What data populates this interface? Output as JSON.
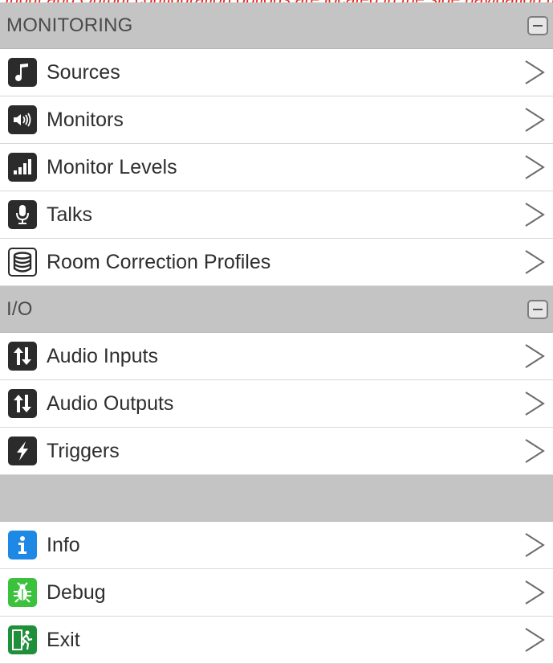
{
  "top_annotation": "Input and Output configuration options are located in the side navigation menu settings",
  "sections": [
    {
      "title": "MONITORING",
      "items": [
        {
          "label": "Sources",
          "icon": "music-note-icon"
        },
        {
          "label": "Monitors",
          "icon": "speaker-volume-icon"
        },
        {
          "label": "Monitor Levels",
          "icon": "signal-bars-icon"
        },
        {
          "label": "Talks",
          "icon": "microphone-icon"
        },
        {
          "label": "Room Correction Profiles",
          "icon": "database-icon"
        }
      ]
    },
    {
      "title": "I/O",
      "items": [
        {
          "label": "Audio Inputs",
          "icon": "up-down-arrows-icon"
        },
        {
          "label": "Audio Outputs",
          "icon": "up-down-arrows-icon"
        },
        {
          "label": "Triggers",
          "icon": "lightning-icon"
        }
      ]
    },
    {
      "title": "",
      "items": [
        {
          "label": "Info",
          "icon": "info-icon"
        },
        {
          "label": "Debug",
          "icon": "bug-icon"
        },
        {
          "label": "Exit",
          "icon": "exit-running-man-icon"
        }
      ]
    }
  ],
  "colors": {
    "header_bg": "#c4c4c4",
    "icon_dark": "#2b2b2b",
    "info_blue": "#1e88e5",
    "debug_green": "#3cc13c",
    "exit_green": "#1f8f3a",
    "annotation_red": "#e8261b"
  }
}
